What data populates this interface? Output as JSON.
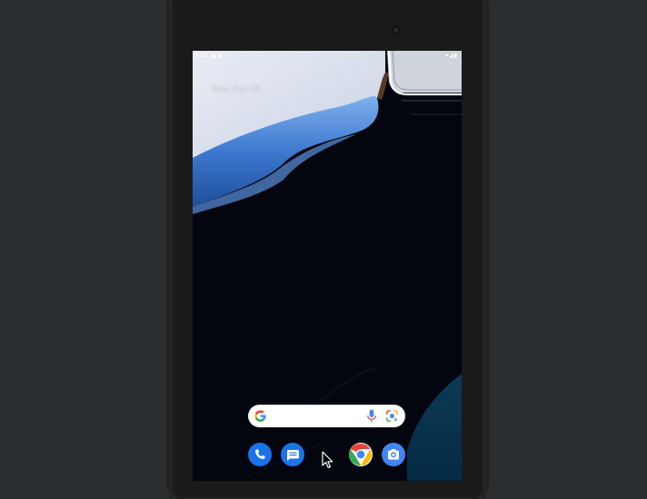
{
  "status_bar": {
    "time": "9:05",
    "left_icons": "▣ ◉",
    "right_icons": "▾◢▮"
  },
  "home": {
    "date_text": "Mon, Sep 26"
  },
  "search_bar": {
    "logo_icon": "google-g-icon",
    "mic_icon": "microphone-icon",
    "lens_icon": "google-lens-icon"
  },
  "dock": {
    "apps": [
      "phone",
      "messages",
      "chrome",
      "camera"
    ]
  },
  "colors": {
    "screen_background": "#03060f",
    "wave_blue": "#4a86d8",
    "wave_light": "#dde2ee",
    "google_blue": "#4285f4",
    "google_red": "#ea4335",
    "google_yellow": "#fbbc05",
    "google_green": "#34a853"
  }
}
